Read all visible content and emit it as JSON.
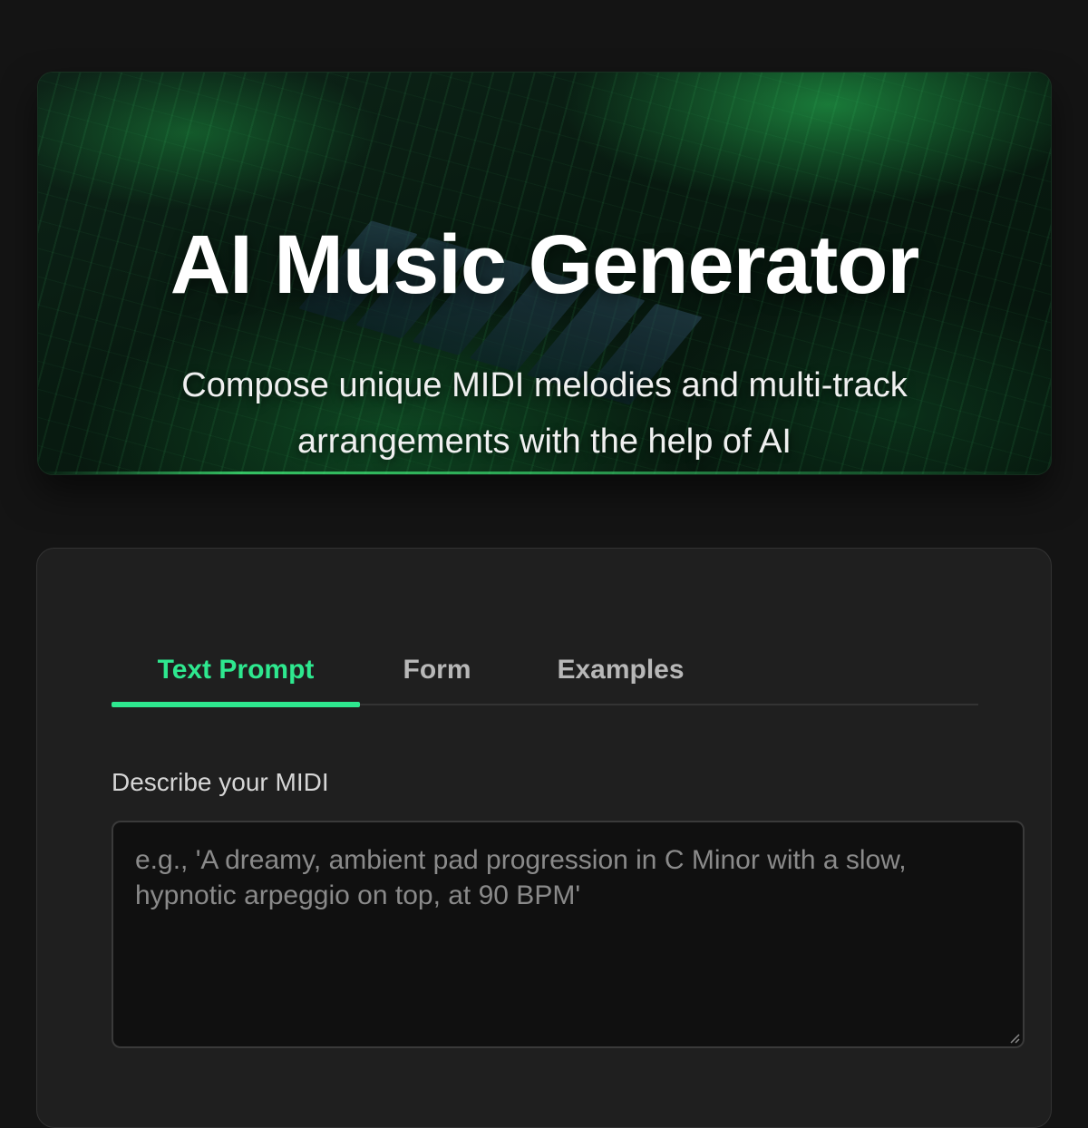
{
  "hero": {
    "title": "AI Music Generator",
    "subtitle": "Compose unique MIDI melodies and multi-track arrangements with the help of AI"
  },
  "tabs": [
    {
      "label": "Text Prompt",
      "active": true
    },
    {
      "label": "Form",
      "active": false
    },
    {
      "label": "Examples",
      "active": false
    }
  ],
  "prompt": {
    "label": "Describe your MIDI",
    "value": "",
    "placeholder": "e.g., 'A dreamy, ambient pad progression in C Minor with a slow, hypnotic arpeggio on top, at 90 BPM'"
  },
  "colors": {
    "accent": "#2ee88f",
    "background": "#141414",
    "panel": "#1f1f1f"
  }
}
